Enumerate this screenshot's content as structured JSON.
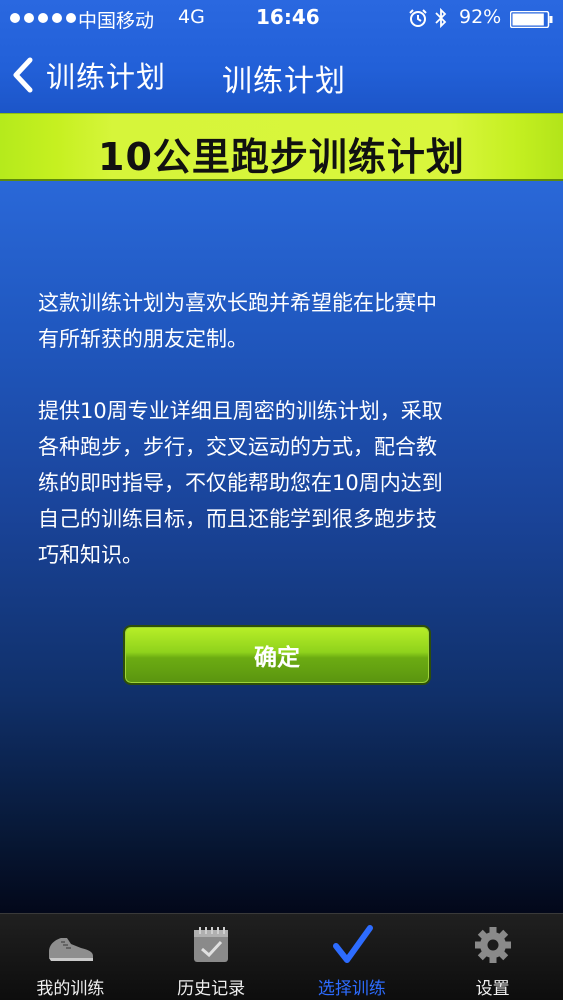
{
  "status_bar": {
    "carrier": "中国移动",
    "network": "4G",
    "time": "16:46",
    "battery": "92%",
    "battery_level": 0.92
  },
  "nav": {
    "back_label": "训练计划",
    "title": "训练计划"
  },
  "banner": {
    "title": "10公里跑步训练计划"
  },
  "description": {
    "line1": "这款训练计划为喜欢长跑并希望能在比赛中",
    "line2": "有所斩获的朋友定制。",
    "line3": "提供10周专业详细且周密的训练计划，采取",
    "line4": "各种跑步，步行，交叉运动的方式，配合教",
    "line5": "练的即时指导，不仅能帮助您在10周内达到",
    "line6": "自己的训练目标，而且还能学到很多跑步技",
    "line7": "巧和知识。"
  },
  "confirm_label": "确定",
  "tabs": [
    {
      "label": "我的训练",
      "icon": "shoe-icon"
    },
    {
      "label": "历史记录",
      "icon": "calendar-check-icon"
    },
    {
      "label": "选择训练",
      "icon": "checkmark-icon",
      "active": true
    },
    {
      "label": "设置",
      "icon": "gear-icon"
    }
  ],
  "colors": {
    "header_blue": "#2260d8",
    "banner_green": "#d6f53a",
    "button_green": "#8fd21c",
    "active_tab": "#2d6cff"
  }
}
